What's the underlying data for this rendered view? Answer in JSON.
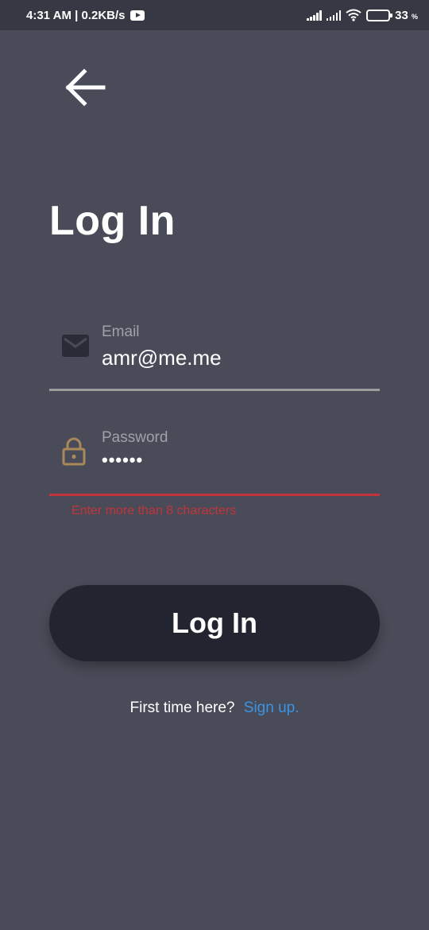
{
  "status_bar": {
    "time_speed": "4:31 AM | 0.2KB/s",
    "battery_percent": "33",
    "battery_unit": "%",
    "battery_level": 0.33,
    "icons": [
      "youtube-icon",
      "signal-icon",
      "signal-icon",
      "wifi-icon",
      "battery-icon"
    ]
  },
  "header": {
    "back_icon": "arrow-left-icon",
    "title": "Log In"
  },
  "form": {
    "email": {
      "label": "Email",
      "value": "amr@me.me",
      "icon": "mail-icon"
    },
    "password": {
      "label": "Password",
      "value": "••••••",
      "icon": "lock-icon",
      "error": "Enter more than 8 characters"
    }
  },
  "submit": {
    "label": "Log In"
  },
  "footer": {
    "prompt": "First time here?",
    "link": "Sign up."
  },
  "colors": {
    "background": "#494c58",
    "status_bar": "#363943",
    "button": "#22252f",
    "error": "#c2343a",
    "link": "#3b93e6",
    "lock_icon": "#a9895a"
  }
}
